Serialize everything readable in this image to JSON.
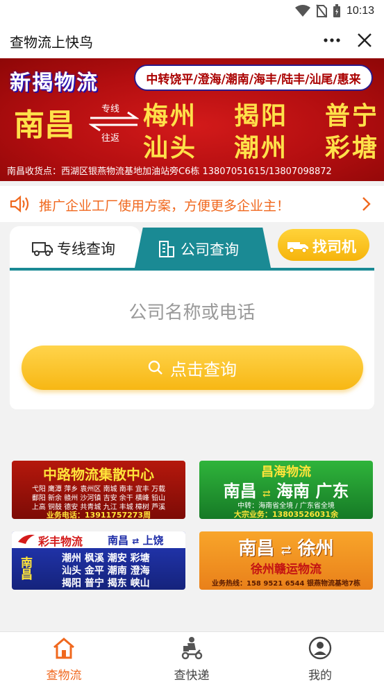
{
  "status_bar": {
    "time": "10:13"
  },
  "header": {
    "title": "查物流上快鸟"
  },
  "banner": {
    "brand": "新揭物流",
    "route": "中转饶平/澄海/潮南/海丰/陆丰/汕尾/惠来",
    "origin": "南昌",
    "arrow_top": "专线",
    "arrow_bottom": "往返",
    "dest_row1": [
      "梅州",
      "揭阳",
      "普宁"
    ],
    "dest_row2": [
      "汕头",
      "潮州",
      "彩塘"
    ],
    "address": "南昌收货点：西湖区银燕物流基地加油站旁C6栋   13807051615/13807098872"
  },
  "notice": {
    "text": "推广企业工厂使用方案，方便更多企业主！"
  },
  "tabs": {
    "line_query": "专线查询",
    "company_query": "公司查询",
    "find_driver": "找司机"
  },
  "search": {
    "placeholder": "公司名称或电话",
    "button": "点击查询"
  },
  "ads": {
    "ad1": {
      "title": "中路物流集散中心",
      "line1": "弋阳 鹰潭 萍乡 袁州区 南城 南丰 宜丰 万载",
      "line2": "鄱阳 新余 赣州 沙河镇 吉安 余干 横峰 铅山",
      "line3": "上高 铜鼓 德安 共青城 九江 丰城 樟树 芦溪",
      "phone": "业务电话：13911757273周"
    },
    "ad2": {
      "title": "昌海物流",
      "route_a": "南昌",
      "route_b": "海南 广东",
      "line1": "中转：海南省全境 / 广东省全境",
      "phone": "大宗业务：13803526031余"
    },
    "ad3": {
      "brand": "彩丰物流",
      "route": "南昌",
      "route_to": "上饶",
      "origin": "南昌",
      "line1": "潮州 枫溪 潮安 彩塘",
      "line2": "汕头 金平 潮南 澄海",
      "line3": "揭阳 普宁 揭东 峡山"
    },
    "ad4": {
      "route_a": "南昌",
      "route_b": "徐州",
      "title": "徐州赣运物流",
      "phone": "业务热线：158 9521 6544 银燕物流基地7栋"
    }
  },
  "nav": {
    "logistics": "查物流",
    "express": "查快递",
    "mine": "我的"
  },
  "colors": {
    "accent": "#f0681e",
    "teal": "#1a8a94",
    "yellow": "#f7b714"
  }
}
